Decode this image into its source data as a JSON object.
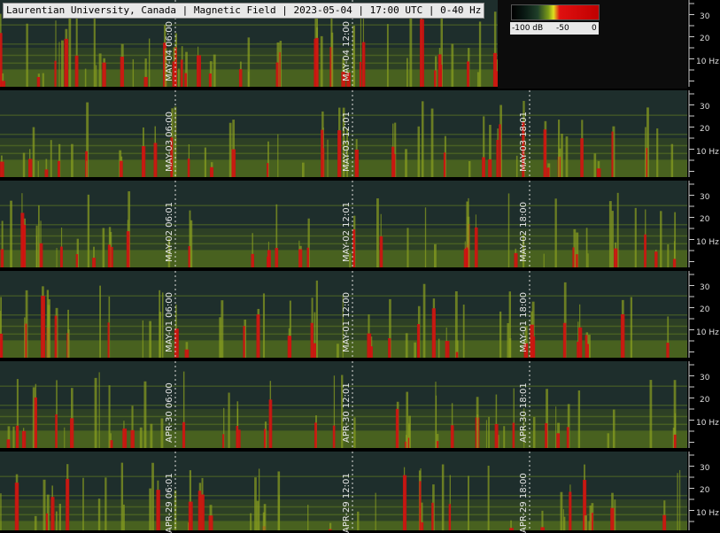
{
  "header": {
    "title": "Laurentian University, Canada | Magnetic Field | 2023-05-04 | 17:00 UTC | 0-40 Hz"
  },
  "legend": {
    "min_label": "-100 dB",
    "mid_label": "-50",
    "max_label": "0"
  },
  "y_axis": {
    "ticks": [
      "30",
      "20",
      "10 Hz"
    ]
  },
  "colors": {
    "background": "#1a2a2a",
    "low": "#203a30",
    "mid": "#8aa020",
    "high": "#d01010"
  },
  "rows": [
    {
      "labels": [
        "MAY-04 06:00",
        "MAY-04 12:00"
      ]
    },
    {
      "labels": [
        "MAY-03 06:00",
        "MAY-03 12:01",
        "MAY-03 18:01"
      ]
    },
    {
      "labels": [
        "MAY-02 06:01",
        "MAY-02 12:01",
        "MAY-02 18:00"
      ]
    },
    {
      "labels": [
        "MAY-01 06:00",
        "MAY-01 12:00",
        "MAY-01 18:00"
      ]
    },
    {
      "labels": [
        "APR-30 06:00",
        "APR-30 12:01",
        "APR-30 18:01"
      ]
    },
    {
      "labels": [
        "APR-29 06:01",
        "APR-29 12:01",
        "APR-29 18:00"
      ]
    }
  ]
}
